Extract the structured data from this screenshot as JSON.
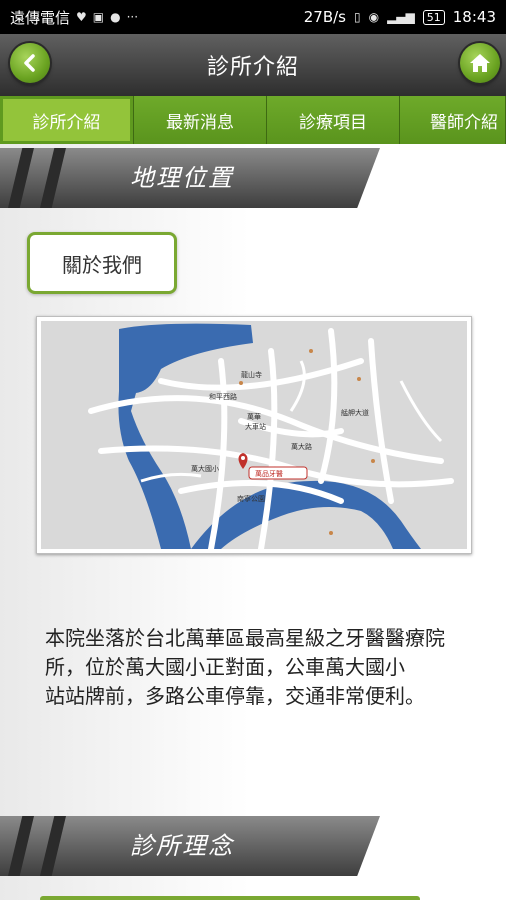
{
  "status_bar": {
    "carrier": "遠傳電信",
    "speed": "27B/s",
    "battery": "51",
    "time": "18:43"
  },
  "header": {
    "title": "診所介紹",
    "back_icon": "chevron-left-icon",
    "home_icon": "home-icon"
  },
  "tabs": [
    {
      "label": "診所介紹",
      "active": true
    },
    {
      "label": "最新消息",
      "active": false
    },
    {
      "label": "診療項目",
      "active": false
    },
    {
      "label": "醫師介紹",
      "active": false
    }
  ],
  "section1": {
    "title": "地理位置"
  },
  "about_button": {
    "label": "關於我們"
  },
  "map": {
    "labels": [
      "萬大國小",
      "南寧公園",
      "萬華",
      "大車站",
      "龍山寺",
      "和平西路",
      "萬大路",
      "艋舺大道"
    ],
    "marker_label": "萬品牙醫"
  },
  "description": "本院坐落於台北萬華區最高星級之牙醫醫療院所，位於萬大國小正對面，公車萬大國小\n站站牌前，多路公車停靠，交通非常便利。",
  "section2": {
    "title": "診所理念"
  },
  "colors": {
    "accent_green": "#6aa321",
    "dark_header": "#3a3a3a",
    "map_water": "#3a6bb0"
  }
}
